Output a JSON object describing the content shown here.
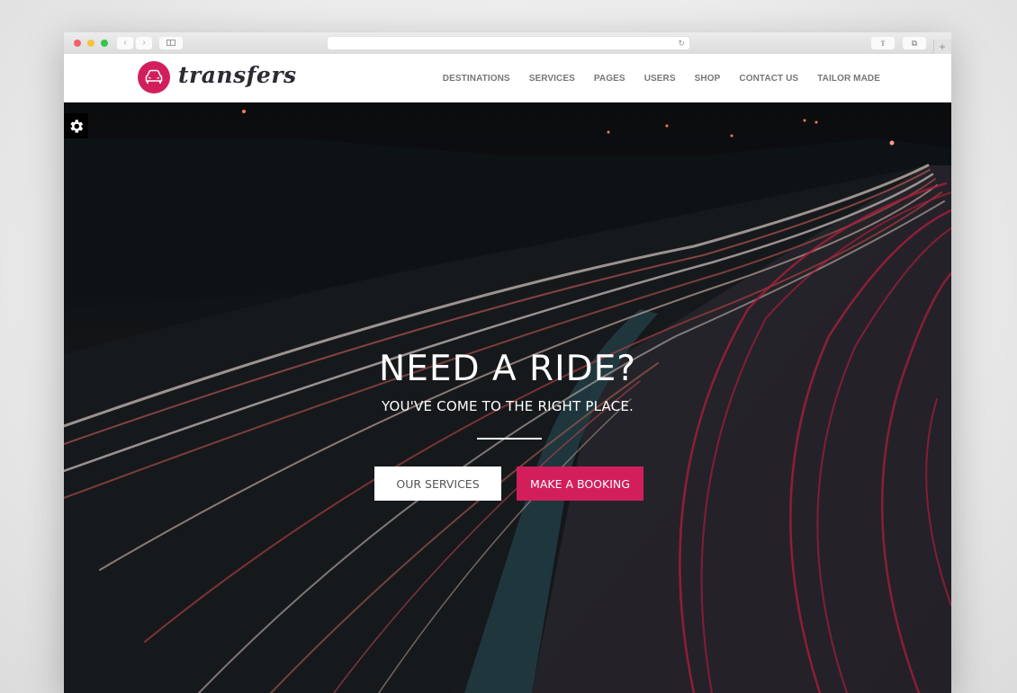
{
  "browser": {
    "back_label": "‹",
    "forward_label": "›",
    "address_value": "",
    "reload_icon": "↻",
    "share_icon": "⇪",
    "tabs_icon": "⧉",
    "new_tab_label": "+"
  },
  "site": {
    "logo_text": "transfers",
    "brand_color": "#d21f5c",
    "nav": [
      {
        "label": "DESTINATIONS"
      },
      {
        "label": "SERVICES"
      },
      {
        "label": "PAGES"
      },
      {
        "label": "USERS"
      },
      {
        "label": "SHOP"
      },
      {
        "label": "CONTACT US"
      },
      {
        "label": "TAILOR MADE"
      }
    ]
  },
  "hero": {
    "title": "NEED A RIDE?",
    "subtitle": "YOU'VE COME TO THE RIGHT PLACE.",
    "buttons": {
      "services": "OUR SERVICES",
      "booking": "MAKE A BOOKING"
    },
    "settings_icon": "gear-icon"
  }
}
